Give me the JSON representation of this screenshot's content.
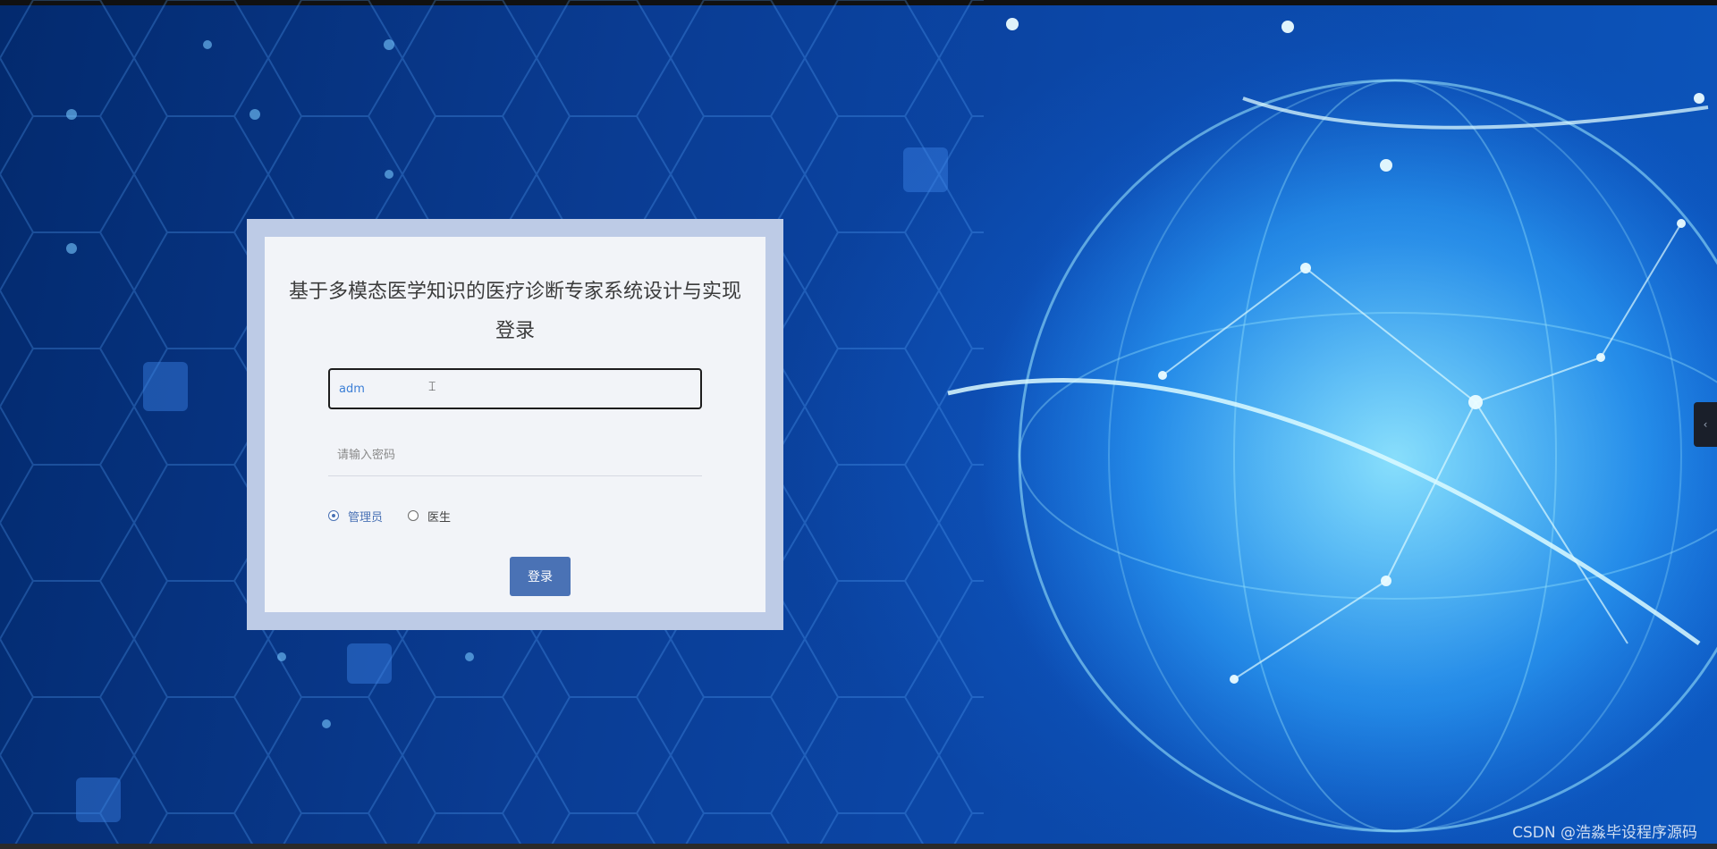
{
  "login": {
    "title": "基于多模态医学知识的医疗诊断专家系统设计与实现登录",
    "username_value": "adm",
    "password_placeholder": "请输入密码",
    "roles": [
      {
        "label": "管理员",
        "checked": true
      },
      {
        "label": "医生",
        "checked": false
      }
    ],
    "submit_label": "登录"
  },
  "colors": {
    "accent": "#4a72b5",
    "frame": "#bdcbe6",
    "card": "#f2f4f8",
    "background": "#0b47a8"
  },
  "icons": {
    "side_tab": "chevron-left-icon",
    "cursor": "text-cursor-icon"
  },
  "watermark": "CSDN @浩淼毕设程序源码"
}
